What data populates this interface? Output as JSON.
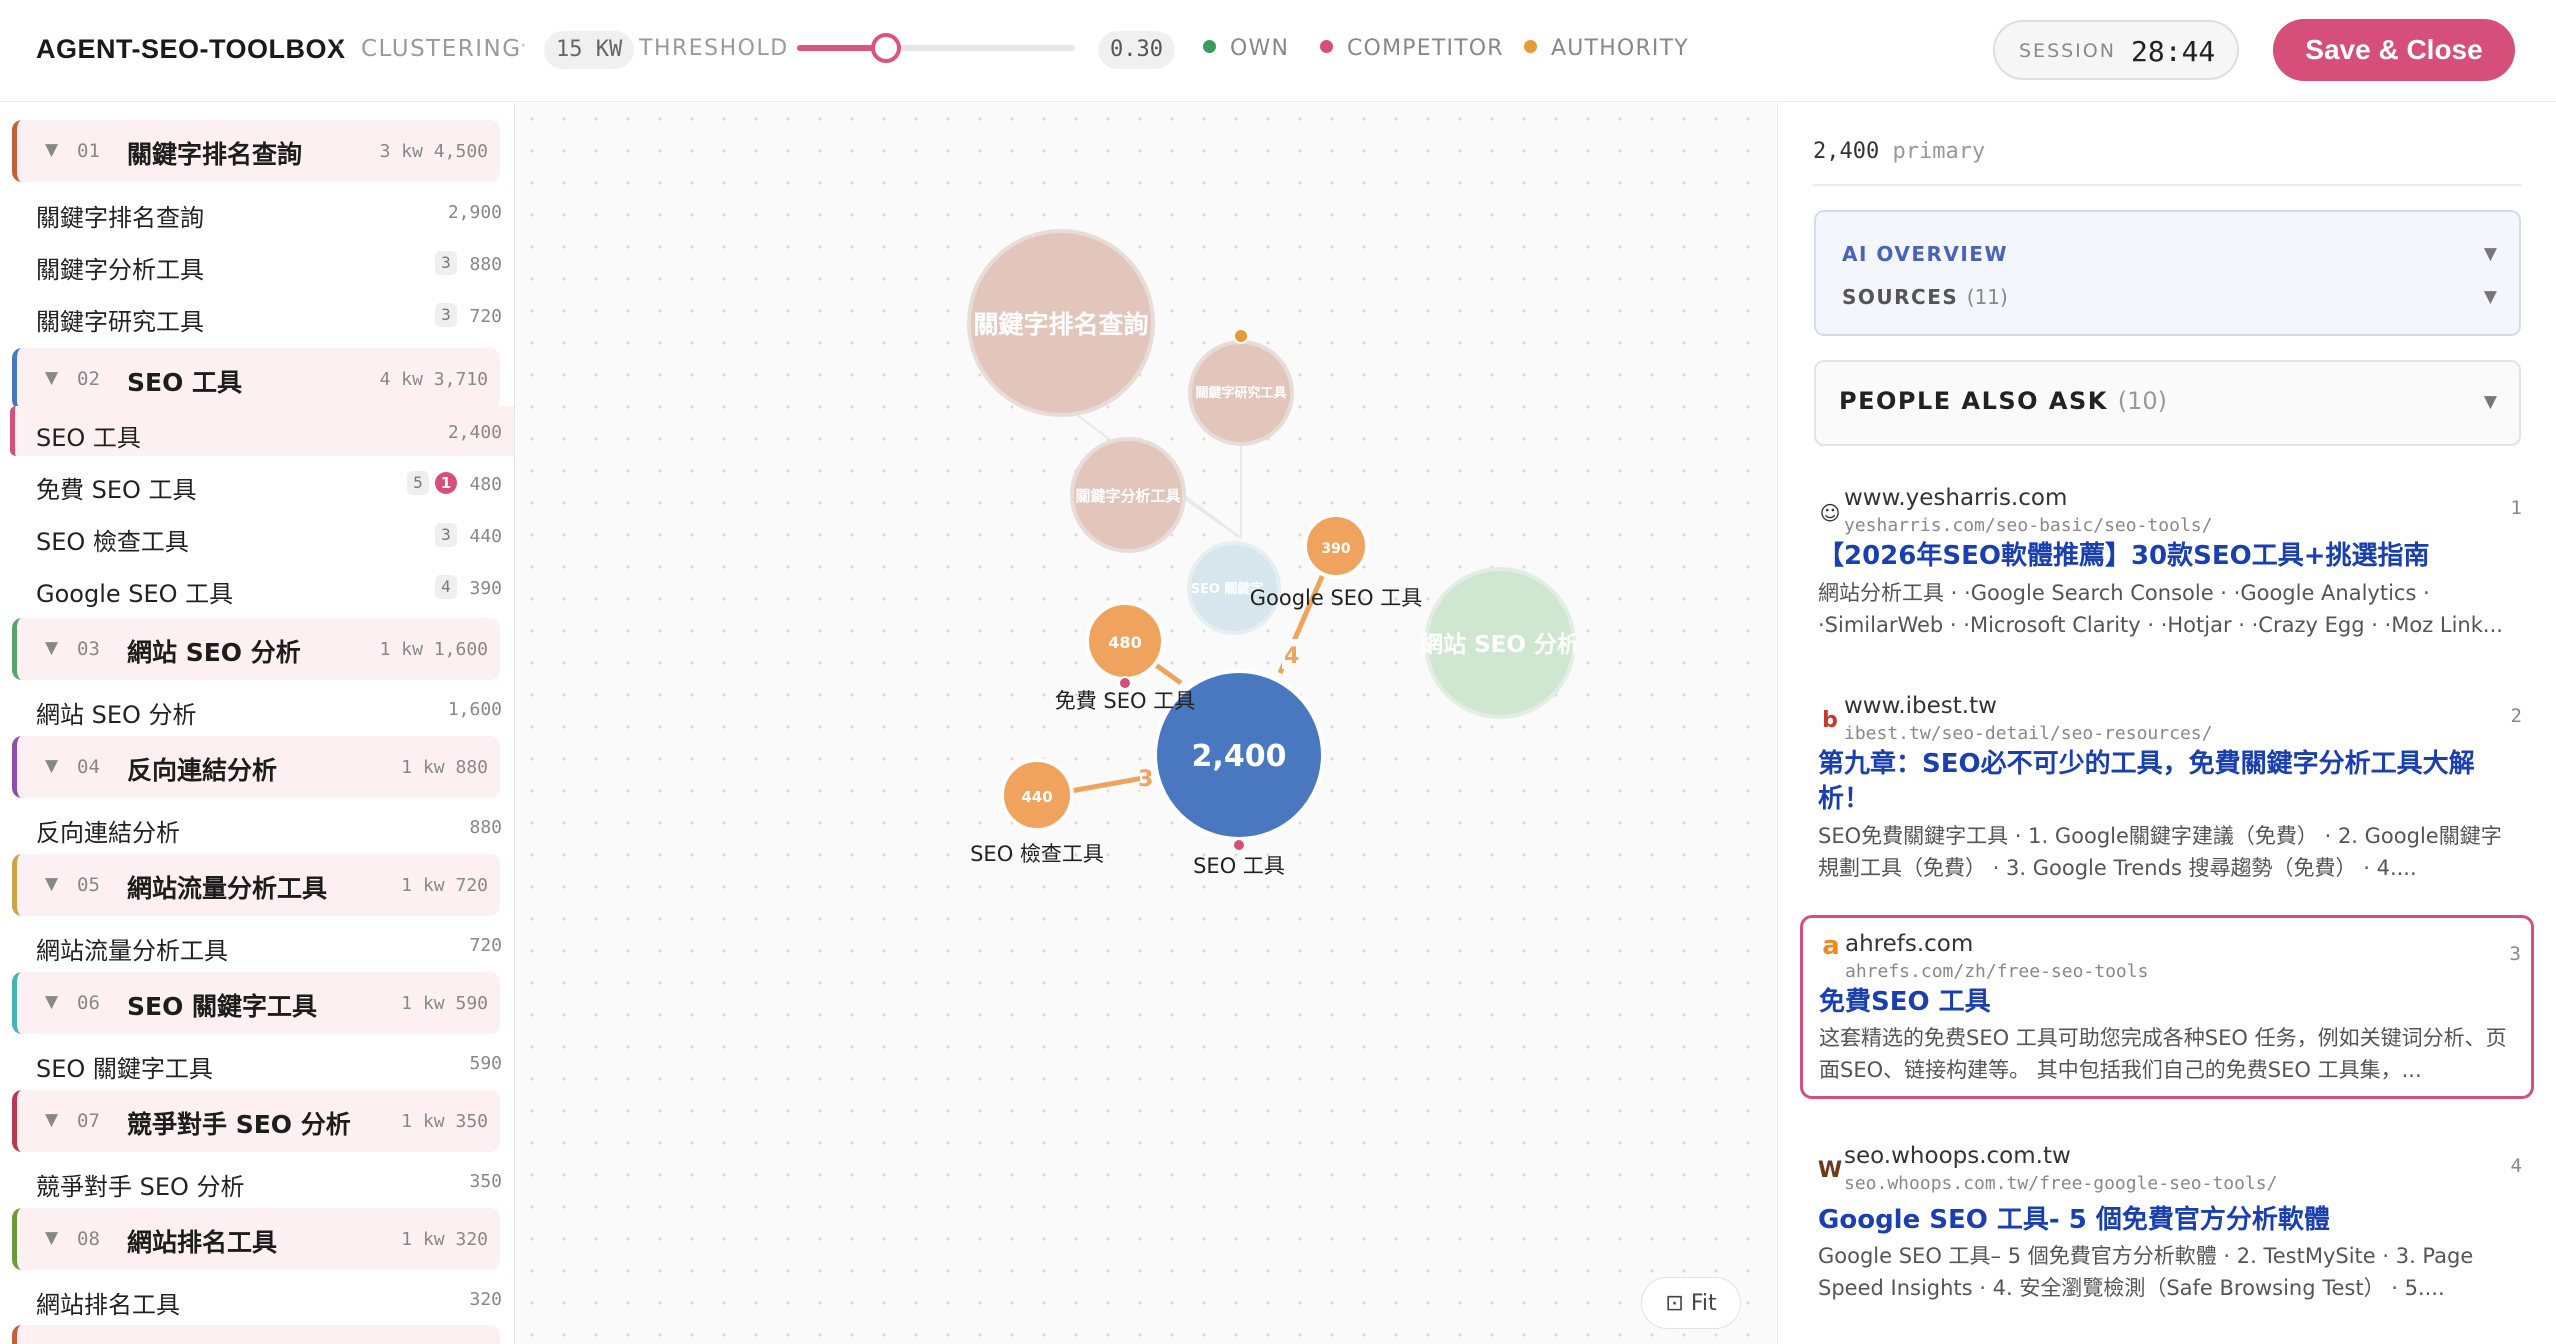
{
  "header": {
    "brand": "AGENT-SEO-TOOLBOX",
    "mode": "CLUSTERING",
    "kw_badge": "15 KW",
    "threshold_label": "THRESHOLD",
    "threshold_value": "0.30",
    "threshold_fraction": 0.32,
    "legend": [
      {
        "label": "OWN",
        "color": "#3a9a5f"
      },
      {
        "label": "COMPETITOR",
        "color": "#d64f7a"
      },
      {
        "label": "AUTHORITY",
        "color": "#e79a3a"
      }
    ],
    "session_label": "SESSION",
    "session_time": "28:44",
    "save_label": "Save & Close",
    "sep": "·"
  },
  "sidebar": {
    "groups": [
      {
        "num": "01",
        "name": "關鍵字排名查詢",
        "meta": "3 kw 4,500",
        "color": "#c2603c"
      },
      {
        "num": "02",
        "name": "SEO 工具",
        "meta": "4 kw 3,710",
        "color": "#4a78c0"
      },
      {
        "num": "03",
        "name": "網站 SEO 分析",
        "meta": "1 kw 1,600",
        "color": "#5aa469"
      },
      {
        "num": "04",
        "name": "反向連結分析",
        "meta": "1 kw 880",
        "color": "#8e4fa8"
      },
      {
        "num": "05",
        "name": "網站流量分析工具",
        "meta": "1 kw 720",
        "color": "#c9a548"
      },
      {
        "num": "06",
        "name": "SEO 關鍵字工具",
        "meta": "1 kw 590",
        "color": "#4ab3b8"
      },
      {
        "num": "07",
        "name": "競爭對手 SEO 分析",
        "meta": "1 kw 350",
        "color": "#b83a52"
      },
      {
        "num": "08",
        "name": "網站排名工具",
        "meta": "1 kw 320",
        "color": "#6a9a3a"
      }
    ],
    "keywords": [
      {
        "name": "關鍵字排名查詢",
        "vol": "2,900"
      },
      {
        "name": "關鍵字分析工具",
        "vol": "880",
        "count": "3"
      },
      {
        "name": "關鍵字研究工具",
        "vol": "720",
        "count": "3"
      },
      {
        "name": "SEO 工具",
        "vol": "2,400"
      },
      {
        "name": "免費 SEO 工具",
        "vol": "480",
        "count": "5",
        "comp": "1"
      },
      {
        "name": "SEO 檢查工具",
        "vol": "440",
        "count": "3"
      },
      {
        "name": "Google SEO 工具",
        "vol": "390",
        "count": "4"
      },
      {
        "name": "網站 SEO 分析",
        "vol": "1,600"
      },
      {
        "name": "反向連結分析",
        "vol": "880"
      },
      {
        "name": "網站流量分析工具",
        "vol": "720"
      },
      {
        "name": "SEO 關鍵字工具",
        "vol": "590"
      },
      {
        "name": "競爭對手 SEO 分析",
        "vol": "350"
      },
      {
        "name": "網站排名工具",
        "vol": "320"
      }
    ]
  },
  "graph": {
    "clusters": [
      {
        "label": "關鍵字排名查詢",
        "color": "#e3c6bb"
      },
      {
        "label": "關鍵字研究工具",
        "color": "#e3c6bb"
      },
      {
        "label": "關鍵字分析工具",
        "color": "#e3c6bb"
      },
      {
        "label": "SEO 關鍵字",
        "color": "#d6e6ec"
      },
      {
        "label": "網站 SEO 分析",
        "color": "#cfe6d1"
      }
    ],
    "nodes": [
      {
        "value": "2,400",
        "label": "SEO 工具",
        "color": "#4a78c0"
      },
      {
        "value": "480",
        "label": "免費 SEO 工具",
        "color": "#f0a35c"
      },
      {
        "value": "390",
        "label": "Google SEO 工具",
        "color": "#f0a35c"
      },
      {
        "value": "440",
        "label": "SEO 檢查工具",
        "color": "#f0a35c"
      }
    ],
    "edge_labels": [
      "3",
      "4"
    ],
    "fit_label": "⊡ Fit"
  },
  "right": {
    "primary_value": "2,400",
    "primary_label": "primary",
    "ai_overview": "AI OVERVIEW",
    "sources_label": "SOURCES",
    "sources_count": "(11)",
    "paa_label": "PEOPLE ALSO ASK",
    "paa_count": "(10)",
    "results": [
      {
        "domain": "www.yesharris.com",
        "url": "yesharris.com/seo-basic/seo-tools/",
        "rank": "1",
        "title": "【2026年SEO軟體推薦】30款SEO工具+挑選指南",
        "snippet": "網站分析工具 · ·Google Search Console · ·Google Analytics · ·SimilarWeb · ·Microsoft Clarity · ·Hotjar · ·Crazy Egg · ·Moz Link...",
        "icon": "person-icon"
      },
      {
        "domain": "www.ibest.tw",
        "url": "ibest.tw/seo-detail/seo-resources/",
        "rank": "2",
        "title": "第九章：SEO必不可少的工具，免費關鍵字分析工具大解析！",
        "snippet": "SEO免費關鍵字工具 · 1. Google關鍵字建議（免費） · 2. Google關鍵字規劃工具（免費） · 3. Google Trends 搜尋趨勢（免費） · 4....",
        "icon": "b-logo-icon"
      },
      {
        "domain": "ahrefs.com",
        "url": "ahrefs.com/zh/free-seo-tools",
        "rank": "3",
        "title": "免費SEO 工具",
        "snippet": "这套精选的免费SEO 工具可助您完成各种SEO 任务，例如关键词分析、页面SEO、链接构建等。 其中包括我们自己的免费SEO 工具集，...",
        "icon": "a-logo-icon"
      },
      {
        "domain": "seo.whoops.com.tw",
        "url": "seo.whoops.com.tw/free-google-seo-tools/",
        "rank": "4",
        "title": "Google SEO 工具- 5 個免費官方分析軟體",
        "snippet": "Google SEO 工具– 5 個免費官方分析軟體 · 2. TestMySite · 3. Page Speed Insights · 4. 安全瀏覽檢測（Safe Browsing Test） · 5....",
        "icon": "w-logo-icon"
      }
    ]
  }
}
